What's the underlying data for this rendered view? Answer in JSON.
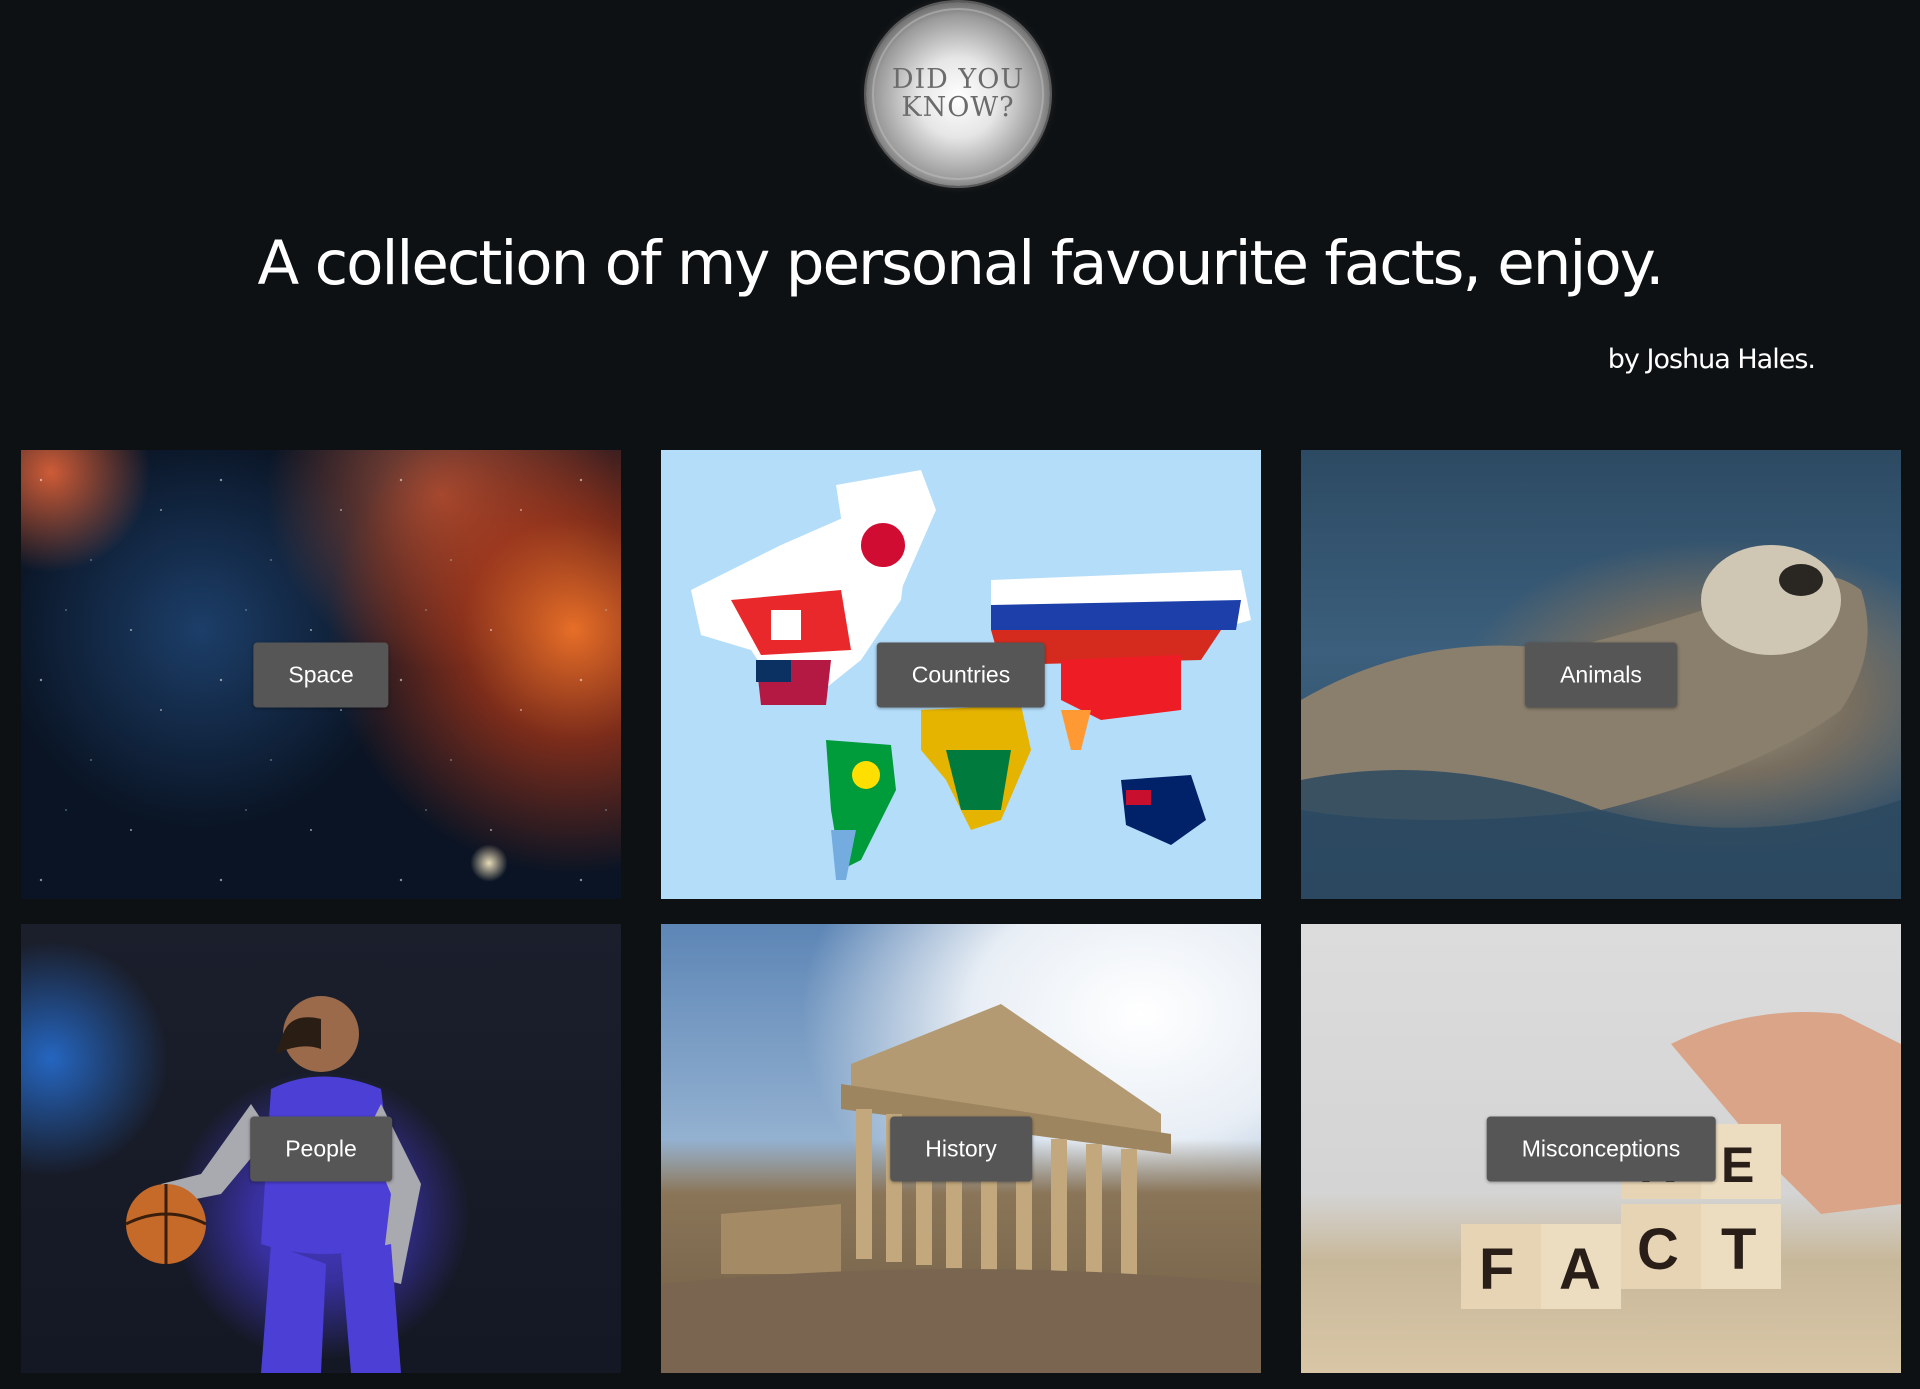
{
  "logo": {
    "line1": "DID YOU",
    "line2": "KNOW?"
  },
  "headline": "A collection of my personal favourite facts, enjoy.",
  "byline": "by Joshua Hales.",
  "categories": [
    {
      "label": "Space",
      "image": "space-nebula"
    },
    {
      "label": "Countries",
      "image": "world-flag-map"
    },
    {
      "label": "Animals",
      "image": "sea-otter"
    },
    {
      "label": "People",
      "image": "basketball-player"
    },
    {
      "label": "History",
      "image": "parthenon"
    },
    {
      "label": "Misconceptions",
      "image": "fake-fact-blocks"
    }
  ],
  "blocks": {
    "bottom": [
      "F",
      "A",
      "C",
      "T"
    ],
    "top": [
      "K",
      "E"
    ]
  }
}
